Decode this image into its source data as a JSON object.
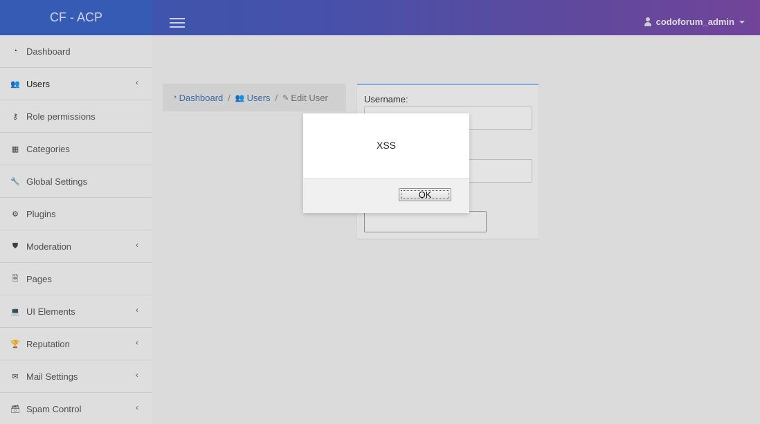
{
  "brand": {
    "title": "CF - ACP"
  },
  "header": {
    "user_name": "codoforum_admin"
  },
  "sidebar": {
    "items": [
      {
        "label": "Dashboard",
        "icon": "dashboard-icon",
        "has_submenu": false
      },
      {
        "label": "Users",
        "icon": "users-icon",
        "has_submenu": true
      },
      {
        "label": "Role permissions",
        "icon": "key-icon",
        "has_submenu": false
      },
      {
        "label": "Categories",
        "icon": "table-icon",
        "has_submenu": false
      },
      {
        "label": "Global Settings",
        "icon": "wrench-icon",
        "has_submenu": false
      },
      {
        "label": "Plugins",
        "icon": "cogs-icon",
        "has_submenu": false
      },
      {
        "label": "Moderation",
        "icon": "shield-icon",
        "has_submenu": true
      },
      {
        "label": "Pages",
        "icon": "file-icon",
        "has_submenu": false
      },
      {
        "label": "UI Elements",
        "icon": "laptop-icon",
        "has_submenu": true
      },
      {
        "label": "Reputation",
        "icon": "trophy-icon",
        "has_submenu": true
      },
      {
        "label": "Mail Settings",
        "icon": "envelope-icon",
        "has_submenu": true
      },
      {
        "label": "Spam Control",
        "icon": "archive-icon",
        "has_submenu": true
      }
    ]
  },
  "breadcrumb": {
    "dashboard": "Dashboard",
    "users": "Users",
    "edit_user": "Edit User",
    "separator": "/"
  },
  "form": {
    "username_label": "Username:"
  },
  "alert": {
    "message": "XSS",
    "ok_label": "OK"
  },
  "colors": {
    "accent": "#3b62c2",
    "link": "#3a73b5",
    "card_border": "#8bb6e6"
  }
}
